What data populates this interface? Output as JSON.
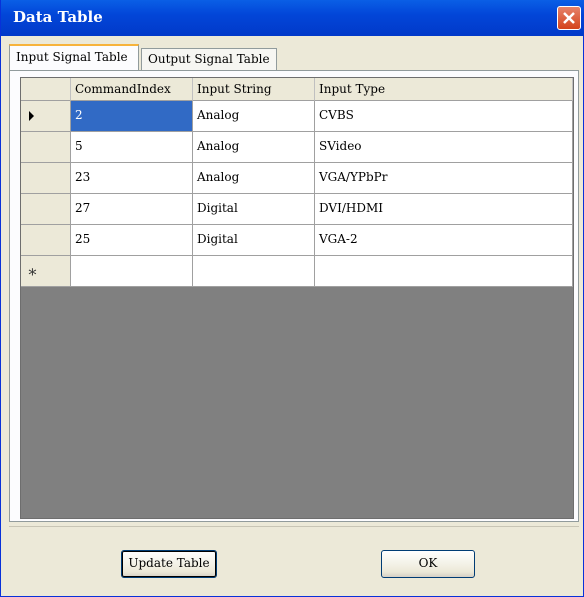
{
  "window": {
    "title": "Data Table"
  },
  "tabs": [
    {
      "label": "Input Signal Table",
      "active": true
    },
    {
      "label": "Output Signal Table",
      "active": false
    }
  ],
  "grid": {
    "columns": [
      "CommandIndex",
      "Input String",
      "Input Type"
    ],
    "rows": [
      {
        "command_index": "2",
        "input_string": "Analog",
        "input_type": "CVBS"
      },
      {
        "command_index": "5",
        "input_string": "Analog",
        "input_type": "SVideo"
      },
      {
        "command_index": "23",
        "input_string": "Analog",
        "input_type": "VGA/YPbPr"
      },
      {
        "command_index": "27",
        "input_string": "Digital",
        "input_type": "DVI/HDMI"
      },
      {
        "command_index": "25",
        "input_string": "Digital",
        "input_type": "VGA-2"
      }
    ],
    "new_row_marker": "∗"
  },
  "buttons": {
    "update": "Update Table",
    "ok": "OK"
  },
  "colors": {
    "titlebar": "#0246d8",
    "selection": "#316ac5",
    "empty_area": "#808080"
  }
}
